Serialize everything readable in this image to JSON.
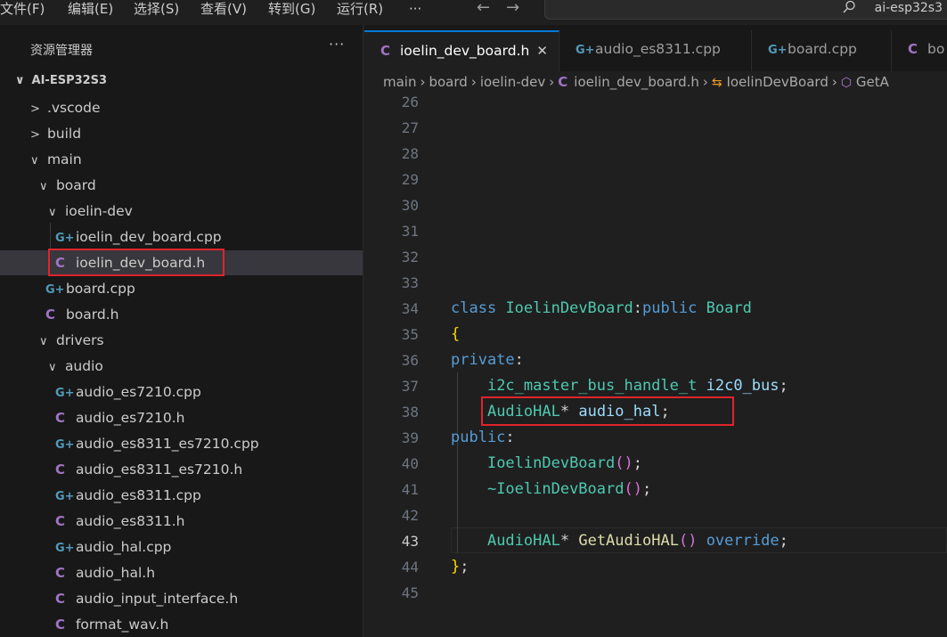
{
  "menu": {
    "items": [
      "文件(F)",
      "编辑(E)",
      "选择(S)",
      "查看(V)",
      "转到(G)",
      "运行(R)",
      "···"
    ],
    "back_arrow": "←",
    "forward_arrow": "→",
    "search_text": "ai-esp32s3"
  },
  "sidebar": {
    "title": "资源管理器",
    "more": "···",
    "root": "AI-ESP32S3",
    "items": [
      {
        "label": ".vscode",
        "kind": "folder",
        "expanded": false
      },
      {
        "label": "build",
        "kind": "folder",
        "expanded": false
      },
      {
        "label": "main",
        "kind": "folder",
        "expanded": true
      },
      {
        "label": "board",
        "kind": "folder",
        "expanded": true
      },
      {
        "label": "ioelin-dev",
        "kind": "folder",
        "expanded": true
      },
      {
        "label": "ioelin_dev_board.cpp",
        "kind": "cpp"
      },
      {
        "label": "ioelin_dev_board.h",
        "kind": "h",
        "selected": true
      },
      {
        "label": "board.cpp",
        "kind": "cpp"
      },
      {
        "label": "board.h",
        "kind": "h"
      },
      {
        "label": "drivers",
        "kind": "folder",
        "expanded": true
      },
      {
        "label": "audio",
        "kind": "folder",
        "expanded": true
      },
      {
        "label": "audio_es7210.cpp",
        "kind": "cpp"
      },
      {
        "label": "audio_es7210.h",
        "kind": "h"
      },
      {
        "label": "audio_es8311_es7210.cpp",
        "kind": "cpp"
      },
      {
        "label": "audio_es8311_es7210.h",
        "kind": "h"
      },
      {
        "label": "audio_es8311.cpp",
        "kind": "cpp"
      },
      {
        "label": "audio_es8311.h",
        "kind": "h"
      },
      {
        "label": "audio_hal.cpp",
        "kind": "cpp"
      },
      {
        "label": "audio_hal.h",
        "kind": "h"
      },
      {
        "label": "audio_input_interface.h",
        "kind": "h"
      },
      {
        "label": "format_wav.h",
        "kind": "h"
      }
    ]
  },
  "tabs": [
    {
      "label": "ioelin_dev_board.h",
      "kind": "h",
      "active": true,
      "close": "✕"
    },
    {
      "label": "audio_es8311.cpp",
      "kind": "cpp"
    },
    {
      "label": "board.cpp",
      "kind": "cpp"
    },
    {
      "label": "bo",
      "kind": "h"
    }
  ],
  "icons": {
    "c_letter": "C",
    "cpp_letter": "G+",
    "class_icon": "⇆",
    "method_icon": "⬡"
  },
  "breadcrumb": {
    "parts": [
      "main",
      "board",
      "ioelin-dev",
      "ioelin_dev_board.h",
      "IoelinDevBoard",
      "GetA"
    ],
    "separator": "›"
  },
  "editor": {
    "current_line": "43",
    "lines": [
      {
        "num": "26",
        "text": ""
      },
      {
        "num": "27",
        "text": ""
      },
      {
        "num": "28",
        "text": ""
      },
      {
        "num": "29",
        "text": ""
      },
      {
        "num": "30",
        "text": ""
      },
      {
        "num": "31",
        "text": ""
      },
      {
        "num": "32",
        "text": ""
      },
      {
        "num": "33",
        "text": ""
      },
      {
        "num": "34",
        "text": "class IoelinDevBoard:public Board"
      },
      {
        "num": "35",
        "text": "{"
      },
      {
        "num": "36",
        "text": "private:"
      },
      {
        "num": "37",
        "text": "    i2c_master_bus_handle_t i2c0_bus;"
      },
      {
        "num": "38",
        "text": "    AudioHAL* audio_hal;"
      },
      {
        "num": "39",
        "text": "public:"
      },
      {
        "num": "40",
        "text": "    IoelinDevBoard();"
      },
      {
        "num": "41",
        "text": "    ~IoelinDevBoard();"
      },
      {
        "num": "42",
        "text": ""
      },
      {
        "num": "43",
        "text": "    AudioHAL* GetAudioHAL() override;"
      },
      {
        "num": "44",
        "text": "};"
      },
      {
        "num": "45",
        "text": ""
      }
    ]
  },
  "colors": {
    "accent": "#0078d4",
    "highlight_box": "#e0242b",
    "cpp_icon": "#519aba",
    "h_icon": "#a074c4"
  }
}
